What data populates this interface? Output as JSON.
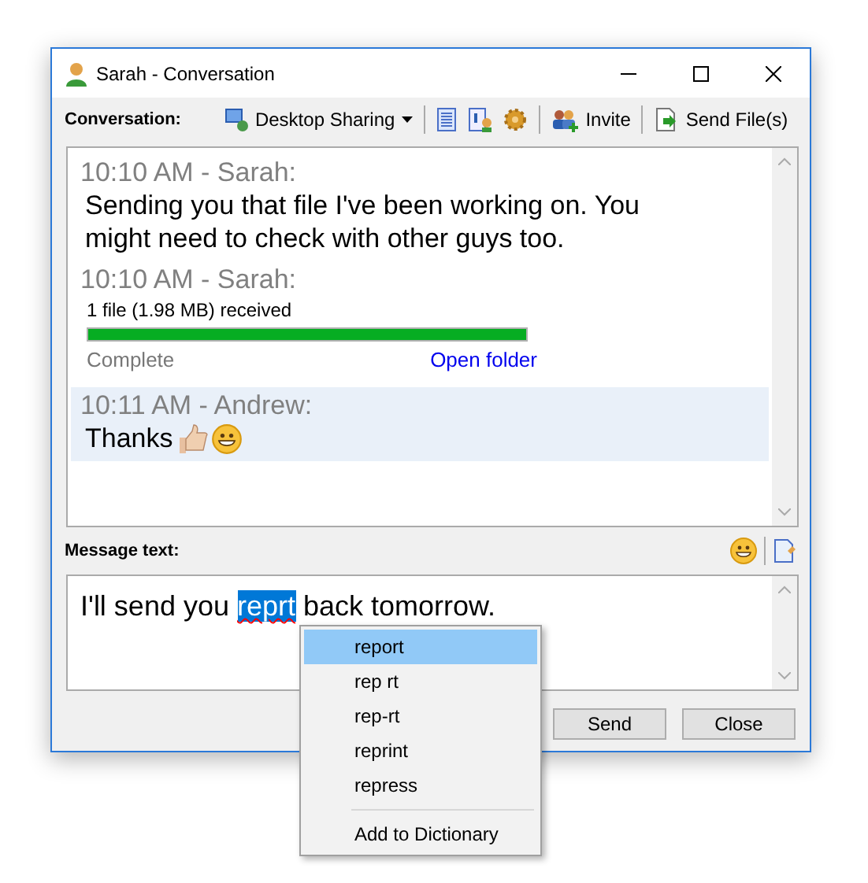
{
  "window": {
    "title": "Sarah - Conversation"
  },
  "toolbar": {
    "label": "Conversation:",
    "items": [
      {
        "kind": "dropdown",
        "label": "Desktop Sharing"
      },
      {
        "kind": "separator"
      },
      {
        "kind": "icon"
      },
      {
        "kind": "icon"
      },
      {
        "kind": "icon"
      },
      {
        "kind": "separator"
      },
      {
        "kind": "button",
        "label": "Invite"
      },
      {
        "kind": "separator"
      },
      {
        "kind": "button",
        "label": "Send File(s)"
      }
    ]
  },
  "messages": [
    {
      "kind": "text",
      "header": "10:10 AM - Sarah:",
      "body": "Sending you that file I've been working on. You might need to check with other guys too.",
      "highlighted": false,
      "emoticons": false
    },
    {
      "kind": "file",
      "header": "10:10 AM - Sarah:",
      "body": "1 file (1.98 MB) received",
      "level": 1,
      "status": "Complete",
      "link": "Open folder",
      "highlighted": false
    },
    {
      "kind": "text",
      "header": "10:11 AM - Andrew:",
      "body": "Thanks",
      "highlighted": true,
      "emoticons": true
    }
  ],
  "compose": {
    "label": "Message text:",
    "before": "I'll send you ",
    "selection": "reprt",
    "after": " back tomorrow."
  },
  "buttons": [
    "Send",
    "Close"
  ],
  "spell_menu": [
    {
      "kind": "suggestion",
      "label": "report",
      "selected": true
    },
    {
      "kind": "suggestion",
      "label": "rep rt",
      "selected": false
    },
    {
      "kind": "suggestion",
      "label": "rep-rt",
      "selected": false
    },
    {
      "kind": "suggestion",
      "label": "reprint",
      "selected": false
    },
    {
      "kind": "suggestion",
      "label": "repress",
      "selected": false
    },
    {
      "kind": "command",
      "label": "Add to Dictionary",
      "selected": false
    }
  ]
}
